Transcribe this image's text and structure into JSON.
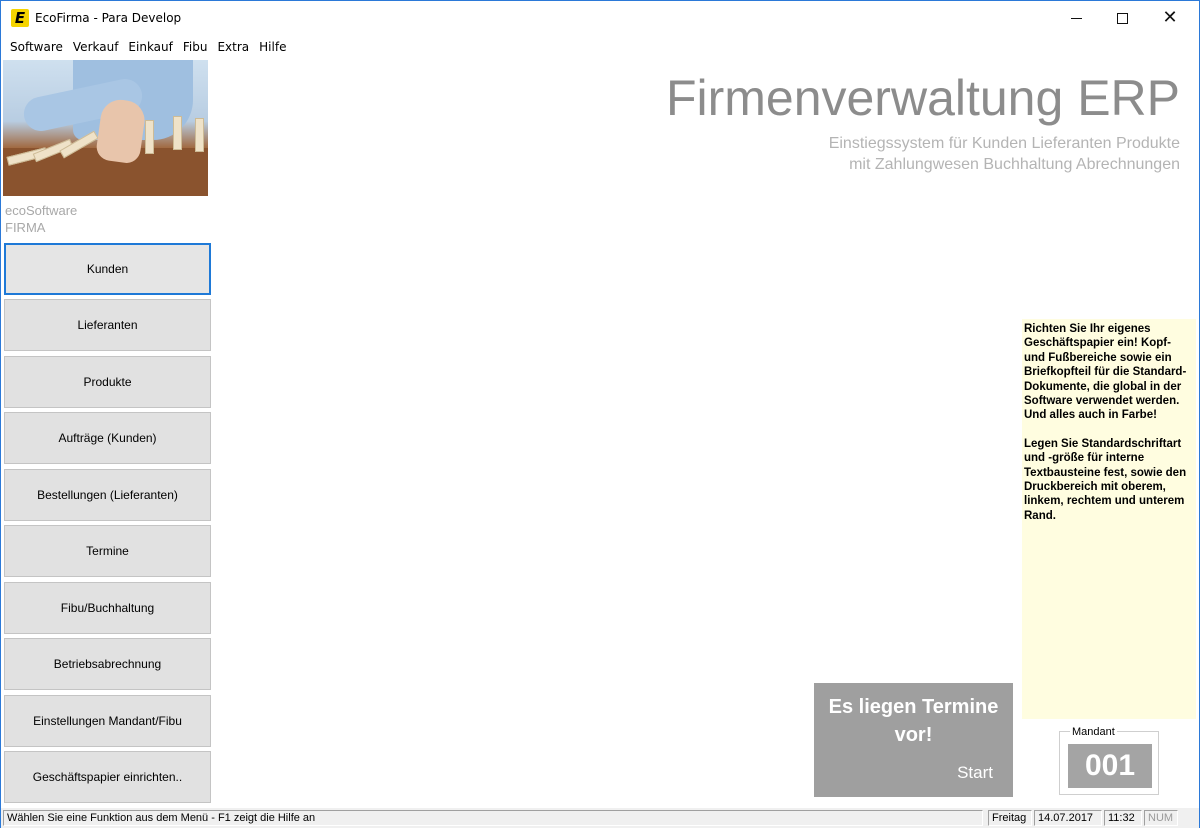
{
  "window": {
    "title": "EcoFirma - Para Develop",
    "app_icon_letter": "E"
  },
  "menu": [
    "Software",
    "Verkauf",
    "Einkauf",
    "Fibu",
    "Extra",
    "Hilfe"
  ],
  "sidebar": {
    "company_line1": "ecoSoftware",
    "company_line2": "FIRMA",
    "buttons": [
      "Kunden",
      "Lieferanten",
      "Produkte",
      "Aufträge (Kunden)",
      "Bestellungen (Lieferanten)",
      "Termine",
      "Fibu/Buchhaltung",
      "Betriebsabrechnung",
      "Einstellungen Mandant/Fibu",
      "Geschäftspapier einrichten.."
    ]
  },
  "header": {
    "title": "Firmenverwaltung ERP",
    "subtitle_line1": "Einstiegssystem für Kunden Lieferanten Produkte",
    "subtitle_line2": "mit Zahlungwesen Buchhaltung Abrechnungen"
  },
  "info": {
    "paragraph1": "Richten Sie Ihr eigenes Geschäftspapier ein! Kopf- und Fußbereiche sowie ein Briefkopfteil für die Standard-Dokumente, die global in der Software verwendet werden. Und alles auch in Farbe!",
    "paragraph2": "Legen Sie Standardschriftart und -größe für interne Textbausteine fest, sowie den Druckbereich mit oberem, linkem, rechtem und unterem Rand."
  },
  "termine": {
    "message": "Es liegen Termine vor!",
    "start_label": "Start"
  },
  "mandant": {
    "label": "Mandant",
    "number": "001"
  },
  "status": {
    "message": "Wählen Sie eine Funktion aus dem Menü - F1 zeigt die Hilfe an",
    "day": "Freitag",
    "date": "14.07.2017",
    "time": "11:32",
    "num": "NUM"
  },
  "colors": {
    "accent": "#1e79d7",
    "info_background": "#fffde0",
    "termine_background": "#9f9f9f"
  }
}
